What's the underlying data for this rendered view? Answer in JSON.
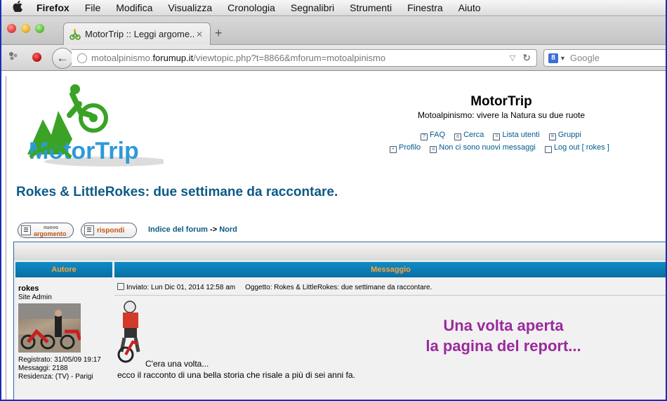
{
  "menubar": {
    "app": "Firefox",
    "items": [
      "File",
      "Modifica",
      "Visualizza",
      "Cronologia",
      "Segnalibri",
      "Strumenti",
      "Finestra",
      "Aiuto"
    ]
  },
  "tab": {
    "title": "MotorTrip :: Leggi argome...",
    "close": "✕"
  },
  "newtab": "+",
  "address": {
    "prefix": "motoalpinismo.",
    "domain": "forumup.it",
    "path": "/viewtopic.php?t=8866&mforum=motoalpinismo"
  },
  "search": {
    "placeholder": "Google"
  },
  "site": {
    "title": "MotorTrip",
    "description": "Motoalpinismo: vivere la Natura su due ruote",
    "logo_text": "MotorTrip"
  },
  "header_links": {
    "row1": [
      "FAQ",
      "Cerca",
      "Lista utenti",
      "Gruppi"
    ],
    "row2": [
      "Profilo",
      "Non ci sono nuovi messaggi",
      "Log out [ rokes ]"
    ]
  },
  "topic": {
    "title": "Rokes & LittleRokes: due settimane da raccontare."
  },
  "buttons": {
    "new_top": "nuovo",
    "new_bottom": "argomento",
    "reply": "rispondi"
  },
  "breadcrumb": {
    "index": "Indice del forum",
    "arrow": "->",
    "forum": "Nord"
  },
  "table": {
    "col_author": "Autore",
    "col_message": "Messaggio"
  },
  "post": {
    "author": "rokes",
    "rank": "Site Admin",
    "registered": "Registrato: 31/05/09 19:17",
    "messages": "Messaggi: 2188",
    "residence": "Residenza: (TV) - Parigi",
    "posted": "Inviato: Lun Dic 01, 2014 12:58 am",
    "subject": "Oggetto: Rokes & LittleRokes: due settimane da raccontare.",
    "line1": "C'era una volta...",
    "line2": "ecco il racconto di una bella storia che risale a più di sei anni fa."
  },
  "overlay": {
    "line1": "Una volta aperta",
    "line2": "la pagina del report..."
  },
  "colors": {
    "link": "#0d5a86",
    "header_bar": "#0a6ea3",
    "header_text": "#ffa438",
    "overlay_text": "#9a2a9e"
  }
}
